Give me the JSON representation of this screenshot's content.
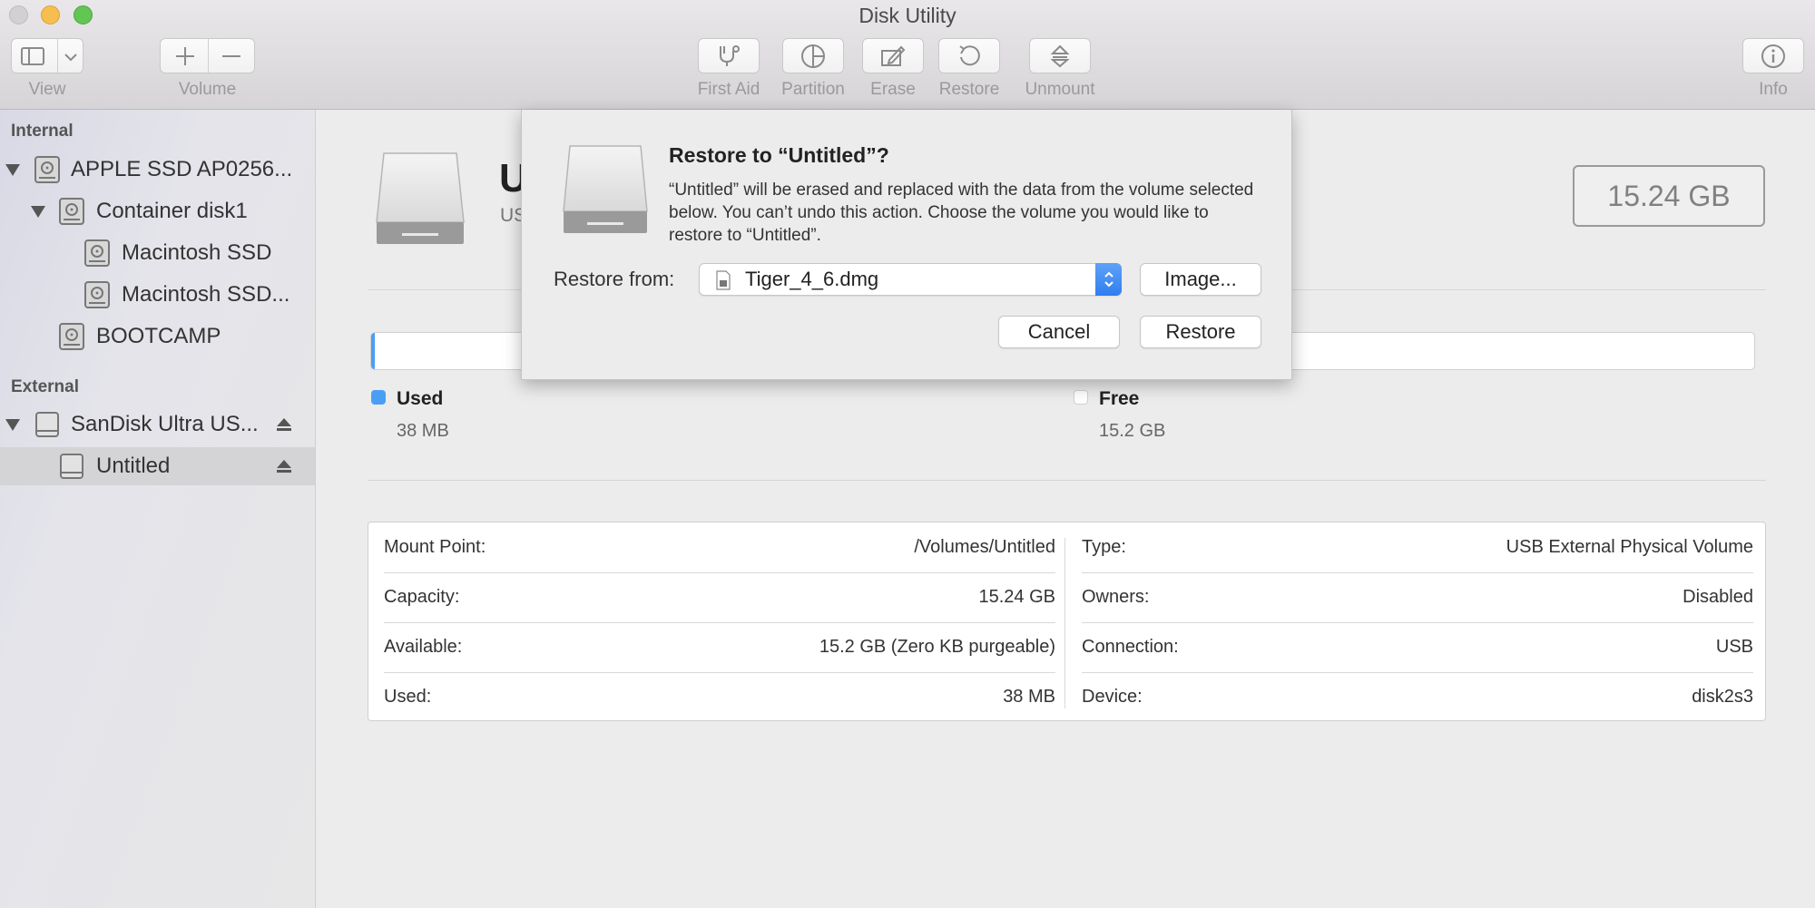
{
  "window": {
    "title": "Disk Utility"
  },
  "toolbar": {
    "view_label": "View",
    "volume_label": "Volume",
    "first_aid_label": "First Aid",
    "partition_label": "Partition",
    "erase_label": "Erase",
    "restore_label": "Restore",
    "unmount_label": "Unmount",
    "info_label": "Info"
  },
  "sidebar": {
    "internal_header": "Internal",
    "external_header": "External",
    "items": [
      {
        "label": "APPLE SSD AP0256..."
      },
      {
        "label": "Container disk1"
      },
      {
        "label": "Macintosh SSD"
      },
      {
        "label": "Macintosh SSD..."
      },
      {
        "label": "BOOTCAMP"
      },
      {
        "label": "SanDisk Ultra US..."
      },
      {
        "label": "Untitled"
      }
    ]
  },
  "volume": {
    "title_initial": "U",
    "subtitle_initial": "US",
    "capacity": "15.24 GB",
    "used_fraction": 0.0025
  },
  "legend": {
    "used_label": "Used",
    "used_value": "38 MB",
    "free_label": "Free",
    "free_value": "15.2 GB",
    "used_color": "#4a9ff5"
  },
  "info": {
    "left": [
      {
        "key": "Mount Point:",
        "value": "/Volumes/Untitled"
      },
      {
        "key": "Capacity:",
        "value": "15.24 GB"
      },
      {
        "key": "Available:",
        "value": "15.2 GB (Zero KB purgeable)"
      },
      {
        "key": "Used:",
        "value": "38 MB"
      }
    ],
    "right": [
      {
        "key": "Type:",
        "value": "USB External Physical Volume"
      },
      {
        "key": "Owners:",
        "value": "Disabled"
      },
      {
        "key": "Connection:",
        "value": "USB"
      },
      {
        "key": "Device:",
        "value": "disk2s3"
      }
    ]
  },
  "dialog": {
    "title": "Restore to “Untitled”?",
    "message": "“Untitled” will be erased and replaced with the data from the volume selected below. You can’t undo this action. Choose the volume you would like to restore to “Untitled”.",
    "restore_from_label": "Restore from:",
    "selected_source": "Tiger_4_6.dmg",
    "image_button": "Image...",
    "cancel_button": "Cancel",
    "restore_button": "Restore"
  }
}
